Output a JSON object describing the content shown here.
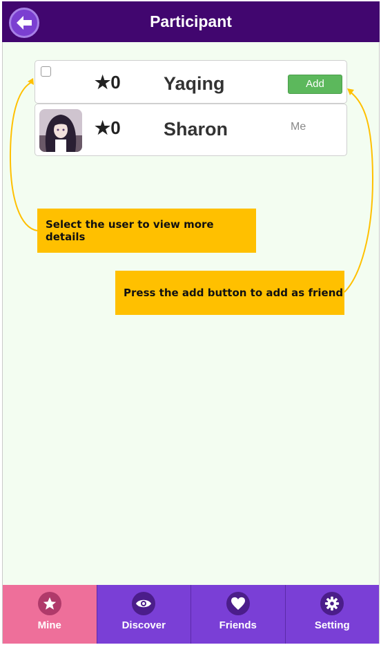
{
  "header": {
    "title": "Participant",
    "back_icon": "arrow-left-icon"
  },
  "participants": [
    {
      "name": "Yaqing",
      "stars": "★0",
      "action": "Add",
      "selected": false
    },
    {
      "name": "Sharon",
      "stars": "★0",
      "status": "Me",
      "avatar": "anime-girl-avatar"
    }
  ],
  "callouts": [
    {
      "text": "Select the user to view more details"
    },
    {
      "text": "Press the add button to add as friend"
    }
  ],
  "tabbar": {
    "items": [
      {
        "label": "Mine",
        "icon": "star-icon",
        "active": true
      },
      {
        "label": "Discover",
        "icon": "eye-icon",
        "active": false
      },
      {
        "label": "Friends",
        "icon": "heart-icon",
        "active": false
      },
      {
        "label": "Setting",
        "icon": "gear-icon",
        "active": false
      }
    ]
  },
  "colors": {
    "header_bg": "#41066f",
    "tab_bg": "#7a3fd6",
    "tab_active_bg": "#ee6f9a",
    "add_button": "#5cb85c",
    "callout_bg": "#ffc000",
    "page_bg": "#f3fdf1"
  }
}
